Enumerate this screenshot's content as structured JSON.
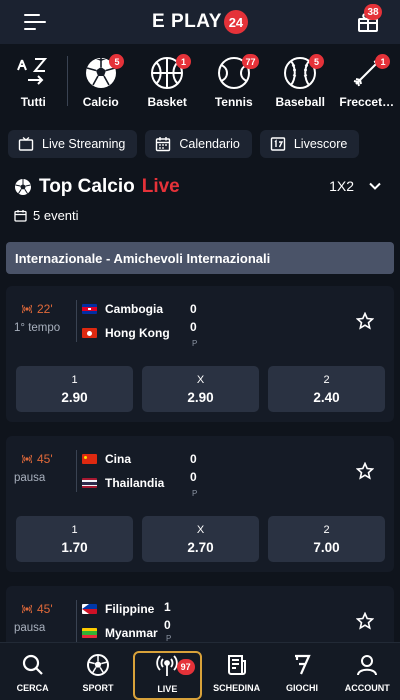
{
  "header": {
    "logo_text": "E PLAY",
    "logo_badge": "24",
    "gift_badge": "38"
  },
  "sports": [
    {
      "label": "Tutti",
      "icon": "az-sort-icon",
      "badge": ""
    },
    {
      "label": "Calcio",
      "icon": "soccer-ball-icon",
      "badge": "5"
    },
    {
      "label": "Basket",
      "icon": "basketball-icon",
      "badge": "1"
    },
    {
      "label": "Tennis",
      "icon": "tennis-ball-icon",
      "badge": "77"
    },
    {
      "label": "Baseball",
      "icon": "baseball-icon",
      "badge": "5"
    },
    {
      "label": "Freccet…",
      "icon": "dart-icon",
      "badge": "1"
    }
  ],
  "filters": [
    {
      "label": "Live Streaming",
      "icon": "tv-icon"
    },
    {
      "label": "Calendario",
      "icon": "calendar-icon"
    },
    {
      "label": "Livescore",
      "icon": "scoreboard-icon"
    }
  ],
  "section": {
    "title": "Top Calcio",
    "title_live": "Live",
    "market": "1X2",
    "events": "5 eventi"
  },
  "competition": "Internazionale - Amichevoli Internazionali",
  "matches": [
    {
      "minute": "22'",
      "period": "1° tempo",
      "home": "Cambogia",
      "away": "Hong Kong",
      "home_score": "0",
      "away_score": "0",
      "p_label": "P",
      "odds": [
        {
          "key": "1",
          "value": "2.90"
        },
        {
          "key": "X",
          "value": "2.90"
        },
        {
          "key": "2",
          "value": "2.40"
        }
      ]
    },
    {
      "minute": "45'",
      "period": "pausa",
      "home": "Cina",
      "away": "Thailandia",
      "home_score": "0",
      "away_score": "0",
      "p_label": "P",
      "odds": [
        {
          "key": "1",
          "value": "1.70"
        },
        {
          "key": "X",
          "value": "2.70"
        },
        {
          "key": "2",
          "value": "7.00"
        }
      ]
    },
    {
      "minute": "45'",
      "period": "pausa",
      "home": "Filippine",
      "away": "Myanmar",
      "home_score": "1",
      "away_score": "0",
      "p_label": "P",
      "odds": []
    }
  ],
  "bottom_nav": [
    {
      "label": "CERCA",
      "icon": "search-icon"
    },
    {
      "label": "SPORT",
      "icon": "soccer-ball-icon"
    },
    {
      "label": "LIVE",
      "icon": "broadcast-icon",
      "badge": "97",
      "active": true
    },
    {
      "label": "SCHEDINA",
      "icon": "betslip-icon"
    },
    {
      "label": "GIOCHI",
      "icon": "seven-icon"
    },
    {
      "label": "ACCOUNT",
      "icon": "user-icon"
    }
  ],
  "colors": {
    "background": "#0f141c",
    "accent_red": "#e53239",
    "live_orange": "#e0693a",
    "active_gold": "#d9a23a",
    "competition_bar": "#4a5368"
  }
}
